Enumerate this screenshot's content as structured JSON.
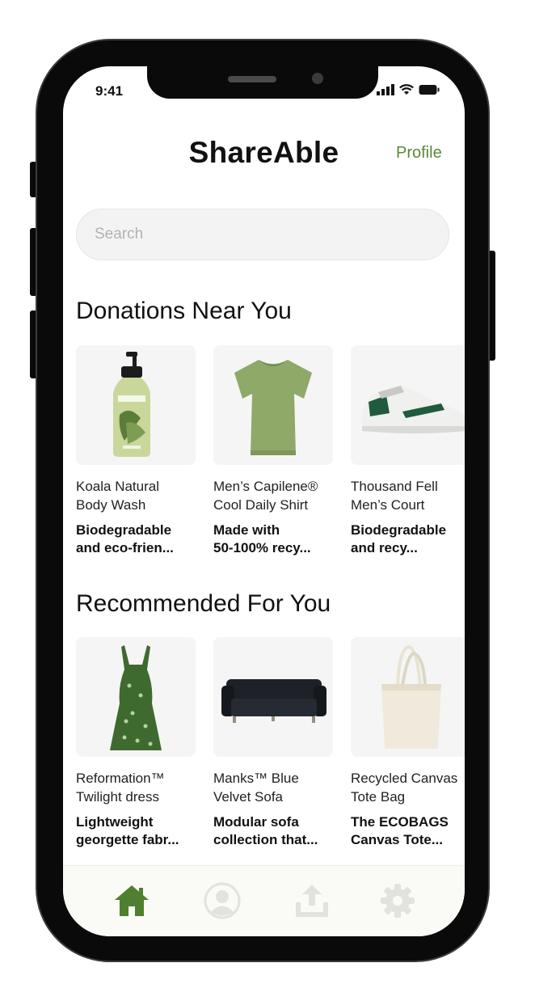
{
  "status_bar": {
    "time": "9:41"
  },
  "header": {
    "title": "ShareAble",
    "profile_link": "Profile"
  },
  "search": {
    "placeholder": "Search"
  },
  "sections": {
    "donations": {
      "title": "Donations Near You",
      "items": [
        {
          "name": "Koala Natural\nBody Wash",
          "description": "Biodegradable\nand eco-frien...",
          "image": "body-wash-bottle"
        },
        {
          "name": "Men’s Capilene®\nCool Daily Shirt",
          "description": "Made with\n50-100% recy...",
          "image": "green-t-shirt"
        },
        {
          "name": "Thousand Fell\nMen’s Court",
          "description": "Biodegradable\nand recy...",
          "image": "white-sneaker"
        }
      ]
    },
    "recommended": {
      "title": "Recommended For You",
      "items": [
        {
          "name": "Reformation™\nTwilight dress",
          "description": "Lightweight\ngeorgette fabr...",
          "image": "green-floral-dress"
        },
        {
          "name": "Manks™ Blue\nVelvet Sofa",
          "description": "Modular sofa\ncollection that...",
          "image": "dark-velvet-sofa"
        },
        {
          "name": "Recycled Canvas\nTote Bag",
          "description": "The ECOBAGS\nCanvas Tote...",
          "image": "canvas-tote-bag"
        }
      ]
    }
  },
  "tab_bar": {
    "tabs": [
      {
        "icon": "home-icon",
        "active": true
      },
      {
        "icon": "profile-icon",
        "active": false
      },
      {
        "icon": "upload-icon",
        "active": false
      },
      {
        "icon": "settings-gear-icon",
        "active": false
      }
    ]
  },
  "colors": {
    "accent": "#5b8a36",
    "tab_active": "#4f7f2f",
    "tab_inactive": "#e2e2de"
  }
}
